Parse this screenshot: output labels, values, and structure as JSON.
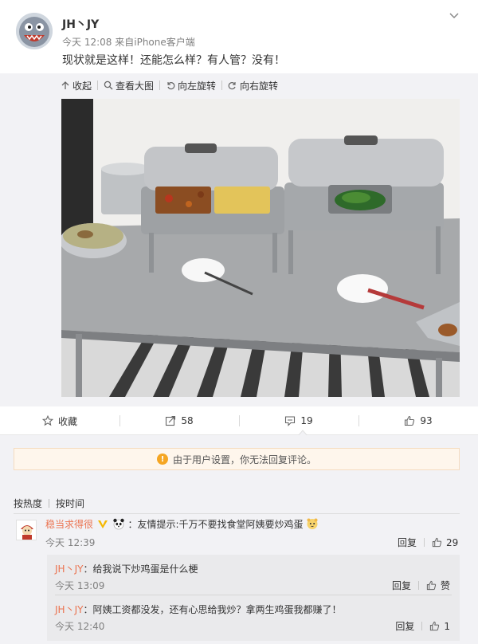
{
  "post": {
    "username": "JH丶JY",
    "time": "今天 12:08",
    "source_prefix": "来自",
    "source": "iPhone客户端",
    "text": "现状就是这样！还能怎么样？有人管？没有！"
  },
  "image_toolbar": {
    "collapse": "收起",
    "view_large": "查看大图",
    "rotate_left": "向左旋转",
    "rotate_right": "向右旋转"
  },
  "actions": {
    "favorite": "收藏",
    "repost_count": "58",
    "comment_count": "19",
    "like_count": "93"
  },
  "notice": {
    "icon": "!",
    "text": "由于用户设置，你无法回复评论。"
  },
  "sort": {
    "by_hot": "按热度",
    "by_time": "按时间"
  },
  "comment": {
    "username": "稳当求得很",
    "text": "：友情提示:千万不要找食堂阿姨要炒鸡蛋",
    "time": "今天 12:39",
    "reply_label": "回复",
    "like_count": "29"
  },
  "replies": [
    {
      "username": "JH丶JY",
      "text": "：给我说下炒鸡蛋是什么梗",
      "time": "今天 13:09",
      "reply_label": "回复",
      "like_label": "赞"
    },
    {
      "username": "JH丶JY",
      "text": "：阿姨工资都没发，还有心思给我炒？拿两生鸡蛋我都赚了！",
      "time": "今天 12:40",
      "reply_label": "回复",
      "like_label": "1"
    }
  ],
  "colors": {
    "username_accent": "#eb7350",
    "notice_bg": "#fef6ec",
    "notice_icon": "#f5a623",
    "page_gray": "#f2f2f5"
  },
  "icons": [
    "chevron-down-icon",
    "collapse-icon",
    "zoom-icon",
    "rotate-left-icon",
    "rotate-right-icon",
    "star-icon",
    "repost-icon",
    "comment-icon",
    "thumb-up-icon",
    "warning-icon",
    "verified-icon",
    "panda-emoji-icon",
    "hamster-emoji-icon"
  ]
}
